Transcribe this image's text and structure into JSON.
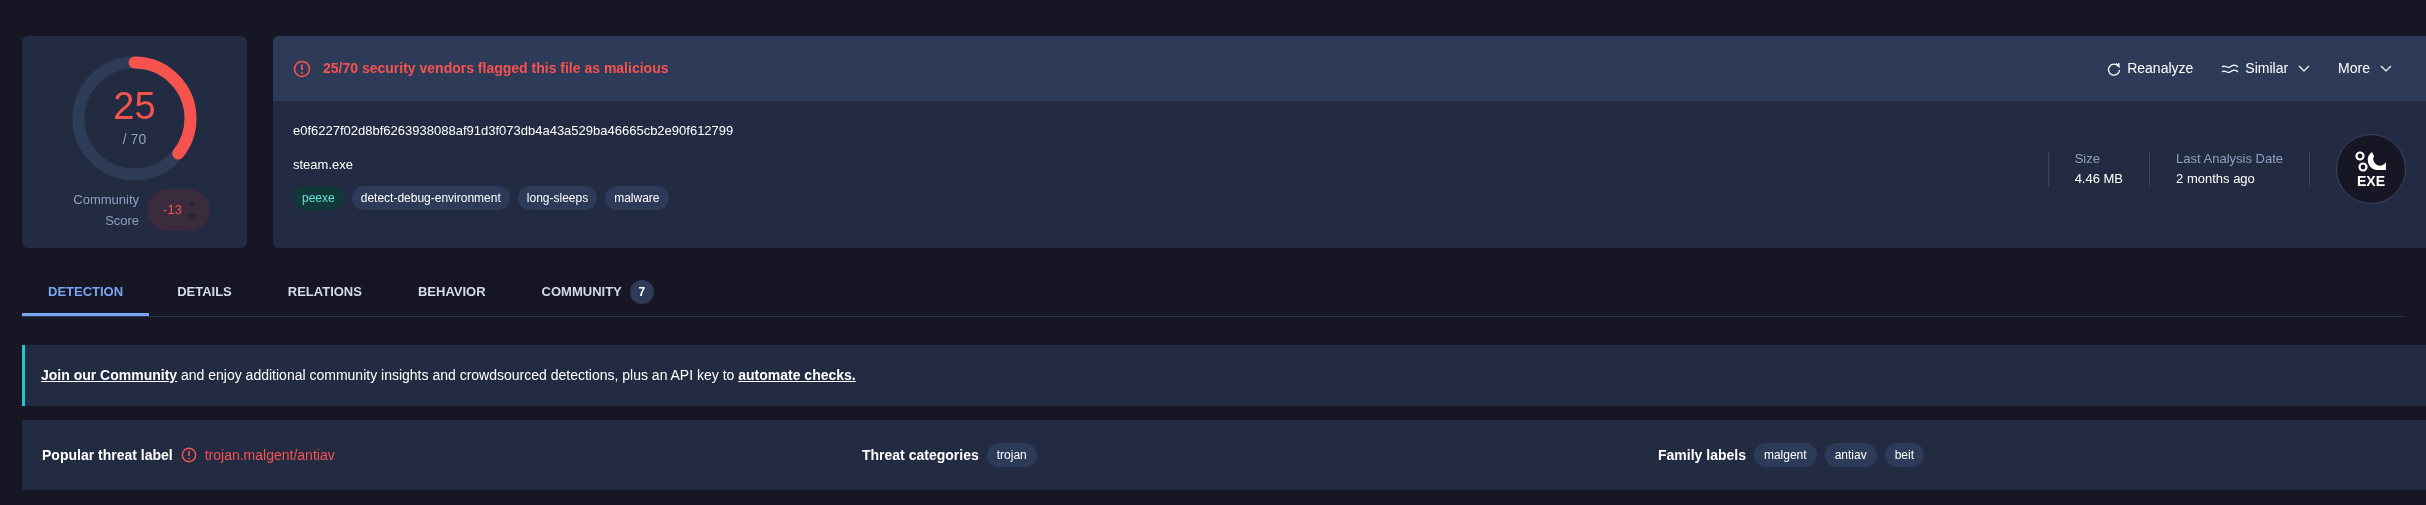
{
  "score": {
    "detections": "25",
    "total": "/ 70",
    "level": 0.357,
    "community_label": "Community Score",
    "community_value": "-13"
  },
  "header": {
    "alert": "25/70 security vendors flagged this file as malicious",
    "actions": [
      {
        "kind": "reanalyze",
        "label": "Reanalyze"
      },
      {
        "kind": "similar",
        "label": "Similar"
      },
      {
        "kind": "more",
        "label": "More"
      }
    ],
    "hash": "e0f6227f02d8bf6263938088af91d3f073db4a43a529ba46665cb2e90f612799",
    "filename": "steam.exe",
    "tags": [
      {
        "label": "peexe",
        "kind": "filetype"
      },
      {
        "label": "detect-debug-environment",
        "kind": "tag"
      },
      {
        "label": "long-sleeps",
        "kind": "tag"
      },
      {
        "label": "malware",
        "kind": "tag"
      }
    ],
    "stats": [
      {
        "label": "Size",
        "value": "4.46 MB"
      },
      {
        "label": "Last Analysis Date",
        "value": "2 months ago"
      }
    ],
    "file_type_icon": "EXE"
  },
  "tabs": [
    {
      "label": "DETECTION",
      "selected": true
    },
    {
      "label": "DETAILS",
      "selected": false
    },
    {
      "label": "RELATIONS",
      "selected": false
    },
    {
      "label": "BEHAVIOR",
      "selected": false
    },
    {
      "label": "COMMUNITY",
      "selected": false,
      "badge": "7"
    }
  ],
  "banner": {
    "text": "**Join our Community** and enjoy additional community insights and crowdsourced detections, plus an API key to **automate checks.**"
  },
  "threat": {
    "popular_label": "Popular threat label",
    "popular_value": "trojan.malgent/antiav",
    "categories_label": "Threat categories",
    "categories": [
      "trojan"
    ],
    "family_label": "Family labels",
    "families": [
      "malgent",
      "antiav",
      "beit"
    ]
  }
}
